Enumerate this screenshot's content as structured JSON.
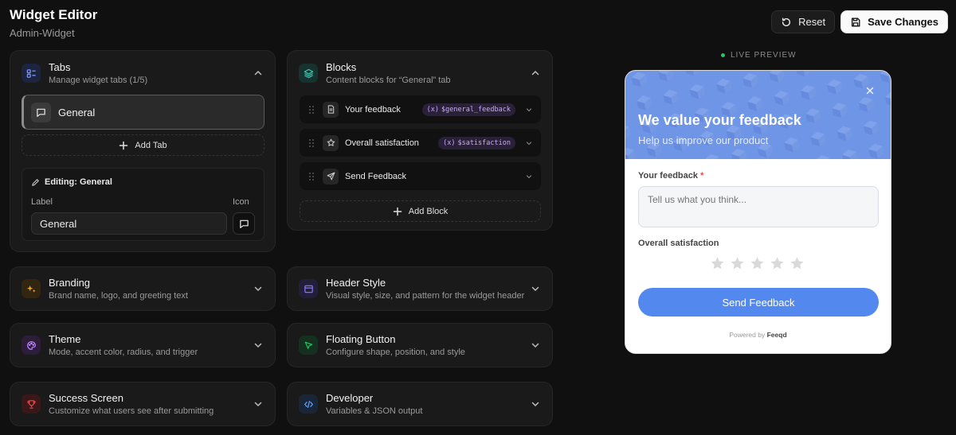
{
  "app": {
    "title": "Widget Editor",
    "subtitle": "Admin-Widget"
  },
  "actions": {
    "reset_label": "Reset",
    "save_label": "Save Changes"
  },
  "tabs_card": {
    "title": "Tabs",
    "desc": "Manage widget tabs (1/5)",
    "items": [
      {
        "label": "General"
      }
    ],
    "add_label": "Add Tab",
    "editing": {
      "title": "Editing: General",
      "label_caption": "Label",
      "icon_caption": "Icon",
      "label_value": "General"
    }
  },
  "blocks_card": {
    "title": "Blocks",
    "desc": "Content blocks for “General” tab",
    "items": [
      {
        "label": "Your feedback",
        "variable": "$general_feedback"
      },
      {
        "label": "Overall satisfaction",
        "variable": "$satisfaction"
      },
      {
        "label": "Send Feedback",
        "variable": ""
      }
    ],
    "add_label": "Add Block"
  },
  "sections": [
    {
      "title": "Branding",
      "desc": "Brand name, logo, and greeting text",
      "icon": "sparkles-icon",
      "color": "#f5a524"
    },
    {
      "title": "Header Style",
      "desc": "Visual style, size, and pattern for the widget header",
      "icon": "layout-icon",
      "color": "#8b7cf6"
    },
    {
      "title": "Theme",
      "desc": "Mode, accent color, radius, and trigger",
      "icon": "palette-icon",
      "color": "#c084fc"
    },
    {
      "title": "Floating Button",
      "desc": "Configure shape, position, and style",
      "icon": "cursor-icon",
      "color": "#22c55e"
    },
    {
      "title": "Success Screen",
      "desc": "Customize what users see after submitting",
      "icon": "trophy-icon",
      "color": "#ef4444"
    },
    {
      "title": "Developer",
      "desc": "Variables & JSON output",
      "icon": "code-icon",
      "color": "#60a5fa"
    }
  ],
  "preview": {
    "live_label": "LIVE PREVIEW",
    "greeting": "We value your feedback",
    "subtext": "Help us improve our product",
    "feedback_label": "Your feedback",
    "required_mark": "*",
    "feedback_placeholder": "Tell us what you think...",
    "satisfaction_label": "Overall satisfaction",
    "stars": 5,
    "send_label": "Send Feedback",
    "powered_prefix": "Powered by",
    "powered_brand": "Feeqd",
    "accent": "#5389ee",
    "header_color": "#6f95e6"
  }
}
